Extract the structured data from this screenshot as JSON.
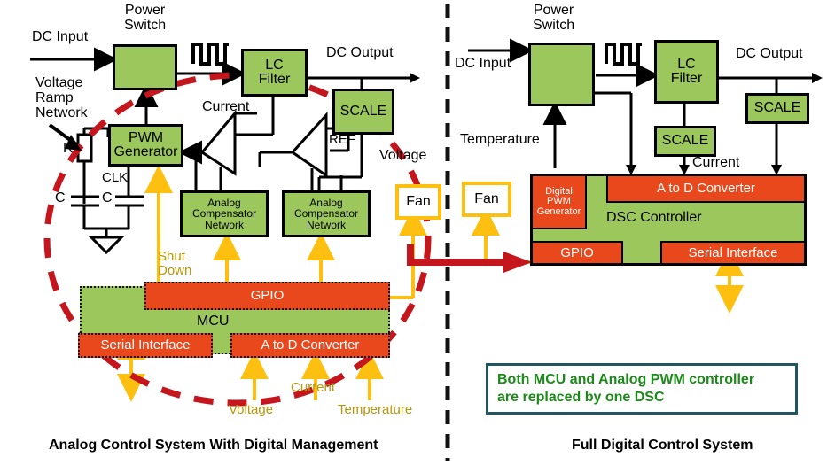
{
  "diagram": {
    "title_left": "Analog Control System With Digital Management",
    "title_right": "Full Digital Control System",
    "colors": {
      "green_block": "#9CC75C",
      "orange_block": "#E8481C",
      "yellow_signal": "#FDC010",
      "yellow_text": "#B8960B",
      "red_dashed_circle": "#C4161C",
      "red_arrow": "#C4161C",
      "callout_border": "#21555F",
      "callout_text": "#1A8A18",
      "wire": "#000000"
    }
  },
  "left_panel": {
    "caption": "Analog Control System With Digital Management",
    "labels": {
      "dc_input": "DC Input",
      "power_switch": "Power\nSwitch",
      "dc_output": "DC Output",
      "voltage_ramp_network": "Voltage\nRamp\nNetwork",
      "resistor": "R",
      "cap_left": "C",
      "cap_right": "C",
      "clk": "CLK",
      "current": "Current",
      "ref": "REF",
      "voltage": "Voltage"
    },
    "blocks": [
      {
        "name": "power-switch",
        "label": "",
        "kind": "green"
      },
      {
        "name": "lc-filter",
        "label": "LC\nFilter",
        "kind": "green"
      },
      {
        "name": "scale",
        "label": "SCALE",
        "kind": "green"
      },
      {
        "name": "pwm-generator",
        "label": "PWM\nGenerator",
        "kind": "green"
      },
      {
        "name": "analog-compensator-network-1",
        "label": "Analog\nCompensator\nNetwork",
        "kind": "green"
      },
      {
        "name": "analog-compensator-network-2",
        "label": "Analog\nCompensator\nNetwork",
        "kind": "green"
      },
      {
        "name": "fan",
        "label": "Fan",
        "kind": "fan"
      }
    ],
    "mcu": {
      "label": "MCU",
      "gpio": "GPIO",
      "serial_interface": "Serial Interface",
      "a_to_d_converter": "A to D Converter"
    },
    "signal_labels": {
      "shut_down": "Shut\nDown",
      "voltage": "Voltage",
      "current": "Current",
      "temperature": "Temperature"
    }
  },
  "right_panel": {
    "caption": "Full Digital Control System",
    "labels": {
      "dc_input": "DC Input",
      "power_switch": "Power\nSwitch",
      "dc_output": "DC Output",
      "temperature": "Temperature",
      "current": "Current"
    },
    "blocks": [
      {
        "name": "power-switch",
        "label": "",
        "kind": "green"
      },
      {
        "name": "lc-filter",
        "label": "LC\nFilter",
        "kind": "green"
      },
      {
        "name": "scale-output",
        "label": "SCALE",
        "kind": "green"
      },
      {
        "name": "scale-current",
        "label": "SCALE",
        "kind": "green"
      },
      {
        "name": "fan",
        "label": "Fan",
        "kind": "fan"
      }
    ],
    "dsc": {
      "label": "DSC Controller",
      "digital_pwm_generator": "Digital\nPWM\nGenerator",
      "a_to_d_converter": "A to D Converter",
      "gpio": "GPIO",
      "serial_interface": "Serial Interface"
    },
    "callout": {
      "line1": "Both MCU and Analog PWM controller",
      "line2": "are replaced by one DSC"
    }
  }
}
